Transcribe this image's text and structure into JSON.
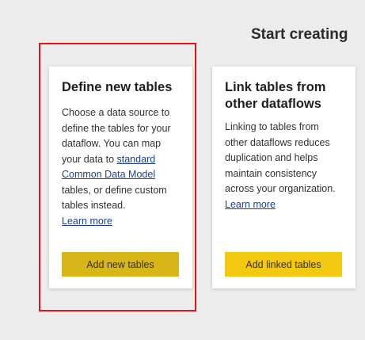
{
  "header": {
    "title": "Start creating"
  },
  "cards": [
    {
      "title": "Define new tables",
      "body_before": "Choose a data source to define the tables for your dataflow. You can map your data to ",
      "link": "standard Common Data Model",
      "body_after": " tables, or define custom tables instead.",
      "learn_more": "Learn more",
      "button": "Add new tables",
      "button_color": "#d9b618"
    },
    {
      "title": "Link tables from other dataflows",
      "body": "Linking to tables from other dataflows reduces duplication and helps maintain consistency across your organization.",
      "learn_more": "Learn more",
      "button": "Add linked tables",
      "button_color": "#f2c811"
    }
  ],
  "highlight_color": "#e8111b"
}
